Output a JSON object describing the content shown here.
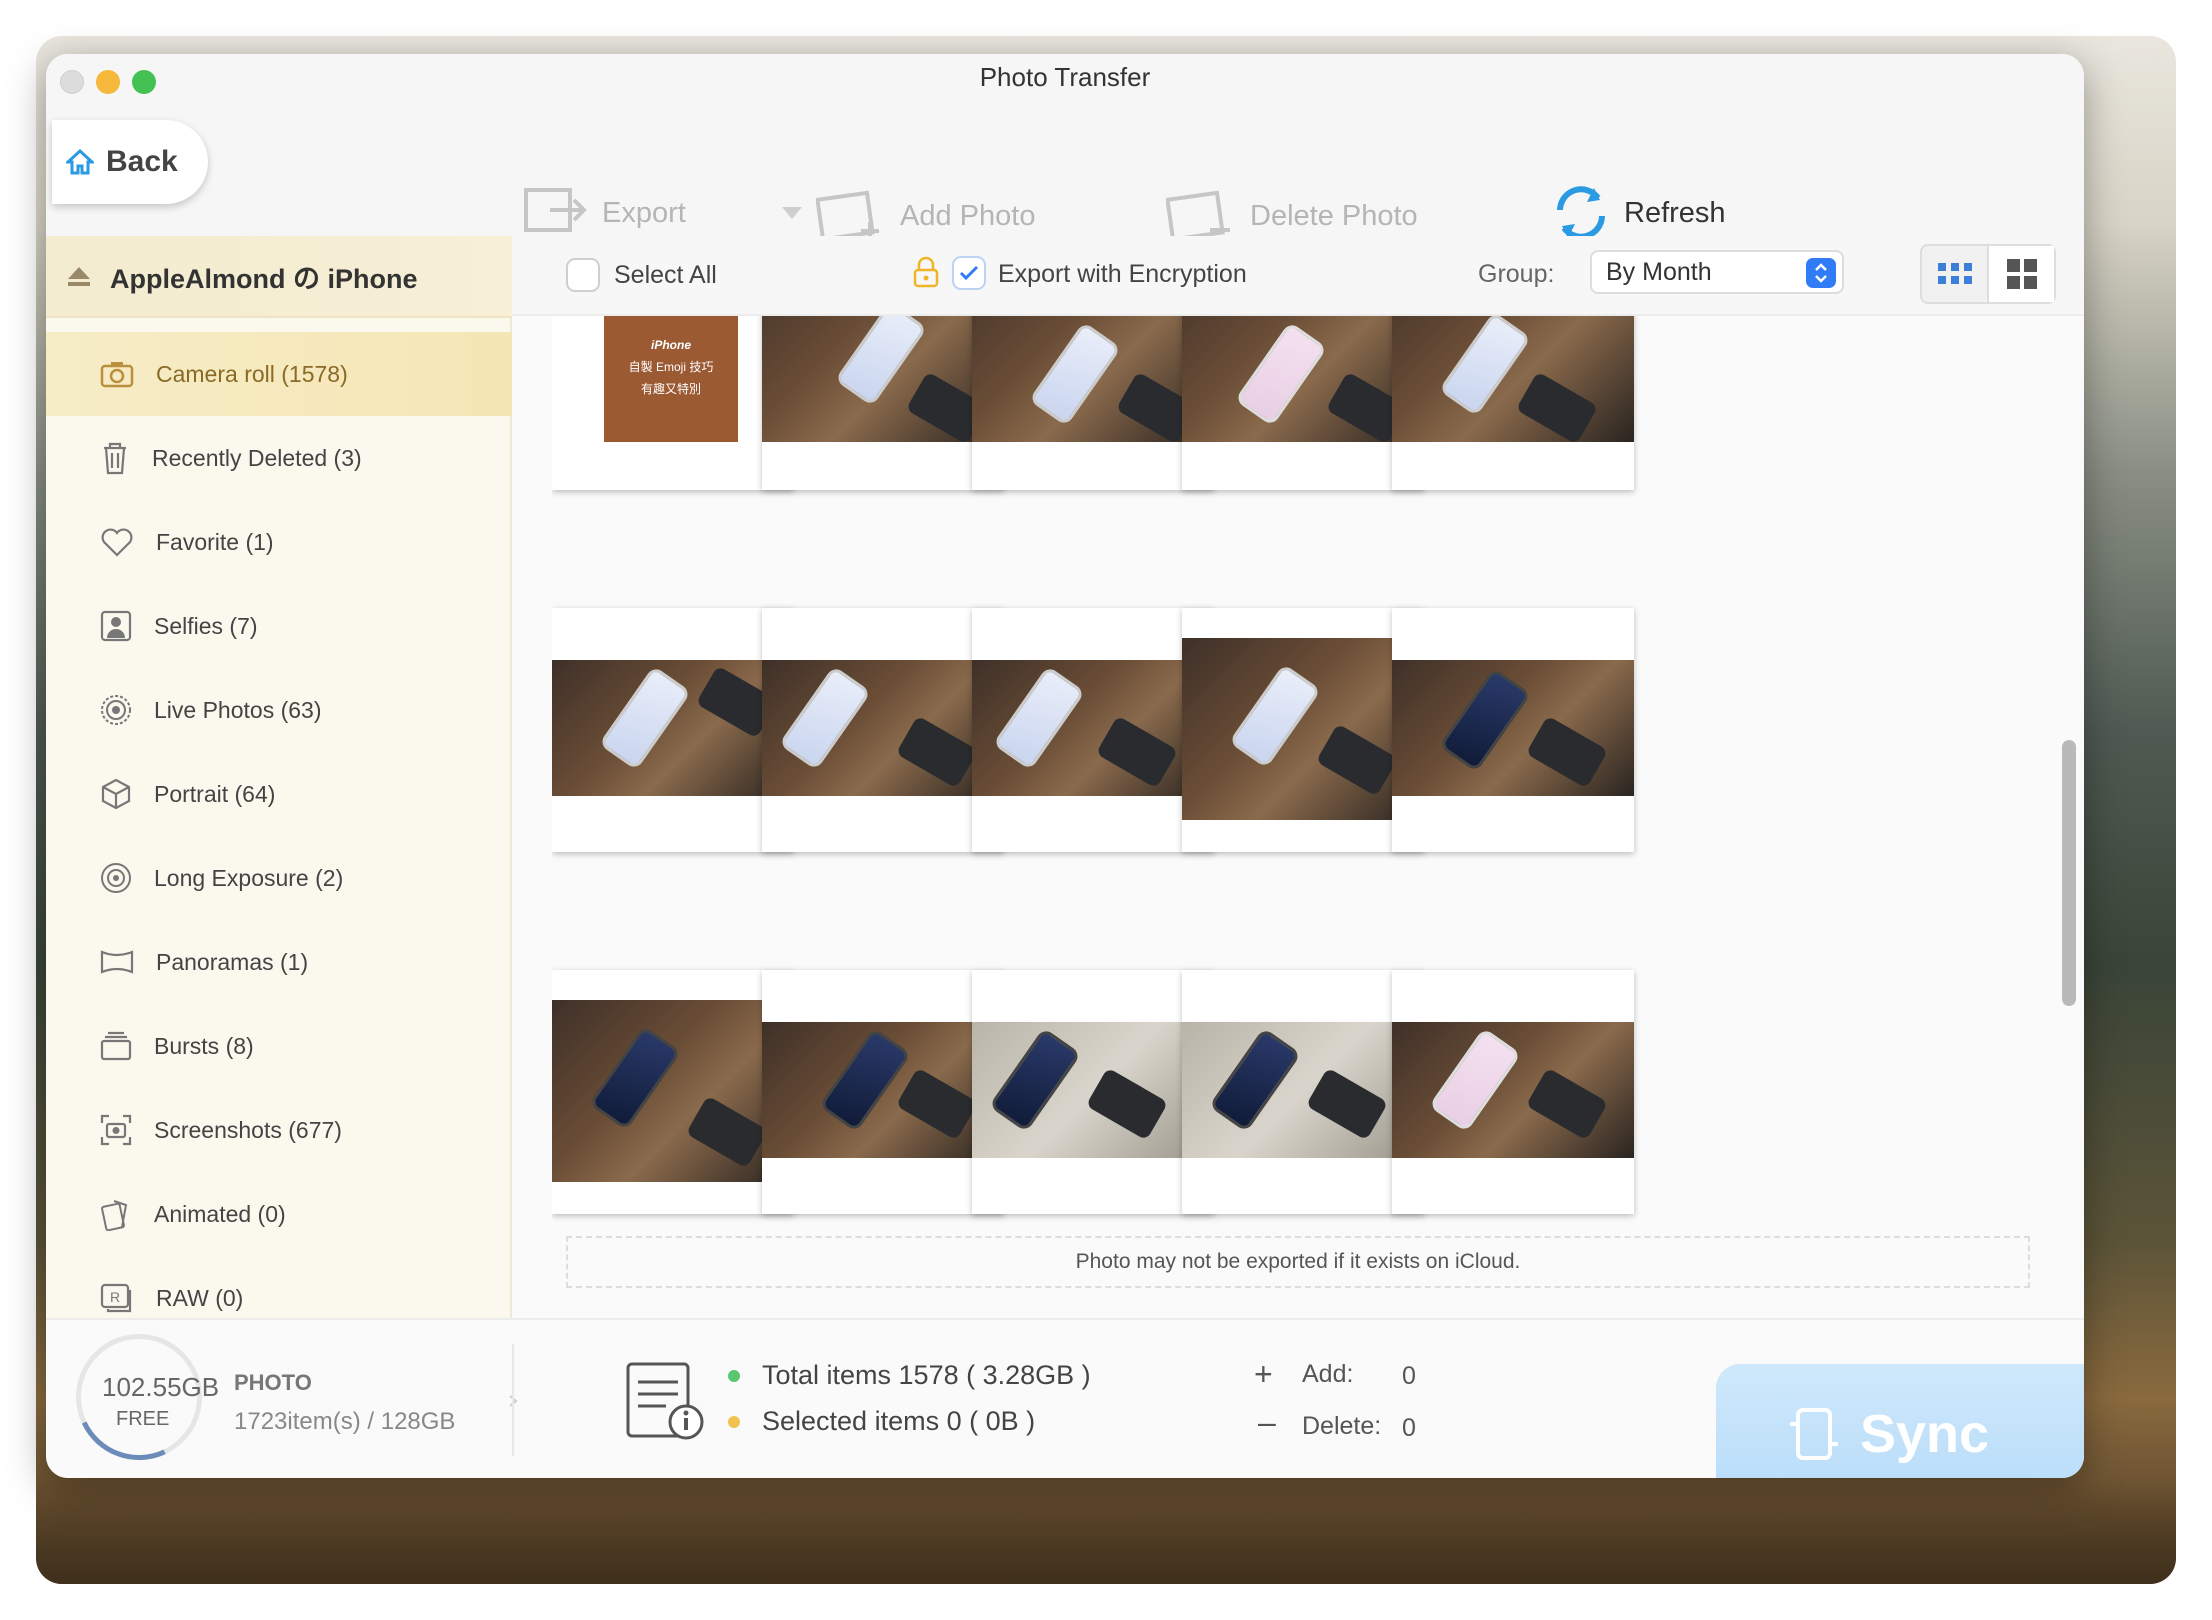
{
  "window": {
    "title": "Photo Transfer"
  },
  "back": {
    "label": "Back"
  },
  "toolbar": {
    "export": "Export",
    "add_photo": "Add Photo",
    "delete_photo": "Delete Photo",
    "refresh": "Refresh"
  },
  "device": {
    "name": "AppleAlmond の iPhone"
  },
  "sidebar": {
    "items": [
      {
        "label": "Camera roll (1578)",
        "icon": "camera-icon"
      },
      {
        "label": "Recently Deleted (3)",
        "icon": "trash-icon"
      },
      {
        "label": "Favorite (1)",
        "icon": "heart-icon"
      },
      {
        "label": "Selfies (7)",
        "icon": "person-icon"
      },
      {
        "label": "Live Photos (63)",
        "icon": "live-photo-icon"
      },
      {
        "label": "Portrait (64)",
        "icon": "cube-icon"
      },
      {
        "label": "Long Exposure (2)",
        "icon": "long-exposure-icon"
      },
      {
        "label": "Panoramas (1)",
        "icon": "panorama-icon"
      },
      {
        "label": "Bursts (8)",
        "icon": "bursts-icon"
      },
      {
        "label": "Screenshots (677)",
        "icon": "screenshot-icon"
      },
      {
        "label": "Animated (0)",
        "icon": "animated-icon"
      },
      {
        "label": "RAW (0)",
        "icon": "raw-icon"
      }
    ]
  },
  "controls": {
    "select_all": "Select All",
    "export_encryption": "Export with Encryption",
    "group_label": "Group:",
    "group_value": "By Month"
  },
  "first_photo_text": {
    "line1": "iPhone",
    "line2": "自製 Emoji 技巧",
    "line3": "有趣又特別"
  },
  "notice": "Photo may not be exported if it exists on iCloud.",
  "storage": {
    "free": "102.55GB",
    "free_label": "FREE",
    "type": "PHOTO",
    "detail": "1723item(s) / 128GB"
  },
  "stats": {
    "total": "Total items 1578 ( 3.28GB )",
    "selected": "Selected items 0 ( 0B )"
  },
  "changes": {
    "add_label": "Add:",
    "add_value": "0",
    "delete_label": "Delete:",
    "delete_value": "0"
  },
  "sync": {
    "label": "Sync"
  },
  "colors": {
    "accent_blue": "#2f7cf6",
    "selected_bg": "#f6ecc6",
    "selected_text": "#8a6a25"
  }
}
